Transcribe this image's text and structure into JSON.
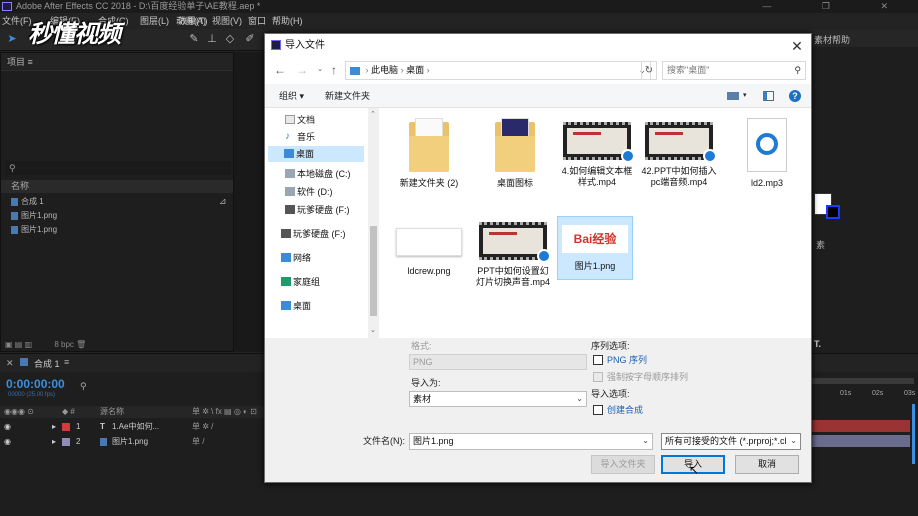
{
  "app": {
    "title": "Adobe After Effects CC 2018 - D:\\百度经验单子\\AE教程.aep *"
  },
  "menu": [
    "文件(F)",
    "编辑(E)",
    "合成(C)",
    "图层(L)",
    "效果(T)",
    "动画(A)",
    "视图(V)",
    "窗口",
    "帮助(H)"
  ],
  "watermark": "秒懂视频",
  "project_panel": {
    "title": "项目",
    "col_name": "名称",
    "items": [
      "合成 1",
      "图片1.png",
      "图片1.png"
    ],
    "bpc": "8 bpc"
  },
  "right_panel": {
    "label_top": "素材帮助",
    "label_mid": "素",
    "label_bot": "T."
  },
  "timeline": {
    "tab": "合成 1",
    "time": "0:00:00:00",
    "sub_time": "00000 (25.00 fps)",
    "col_name": "源名称",
    "layers": [
      {
        "num": "1",
        "type": "T",
        "name": "1.Ae中如何..."
      },
      {
        "num": "2",
        "type": "",
        "name": "图片1.png"
      }
    ],
    "ruler": [
      "01s",
      "02s",
      "03s"
    ]
  },
  "dialog": {
    "title": "导入文件",
    "breadcrumb": [
      "此电脑",
      "桌面"
    ],
    "search_placeholder": "搜索\"桌面\"",
    "organize": "组织 ▾",
    "new_folder": "新建文件夹",
    "nav": [
      "文档",
      "音乐",
      "桌面",
      "本地磁盘 (C:)",
      "软件 (D:)",
      "玩爹硬盘 (F:)",
      "玩爹硬盘 (F:)",
      "网络",
      "家庭组",
      "桌面"
    ],
    "files": [
      {
        "name": "新建文件夹 (2)",
        "kind": "folder"
      },
      {
        "name": "桌面图标",
        "kind": "folder2"
      },
      {
        "name": "4.如何编辑文本框样式.mp4",
        "kind": "video"
      },
      {
        "name": "42.PPT中如何插入pc端音频.mp4",
        "kind": "video"
      },
      {
        "name": "ld2.mp3",
        "kind": "audio"
      },
      {
        "name": "ldcrew.png",
        "kind": "blank"
      },
      {
        "name": "PPT中如何设置幻灯片切换声音.mp4",
        "kind": "video"
      },
      {
        "name": "图片1.png",
        "kind": "baidu"
      }
    ],
    "format_label": "格式:",
    "format_value": "PNG",
    "import_as_label": "导入为:",
    "import_as_value": "素材",
    "seq_label": "序列选项:",
    "seq_png": "PNG 序列",
    "seq_force": "强制按字母顺序排列",
    "import_opts_label": "导入选项:",
    "create_comp": "创建合成",
    "filename_label": "文件名(N):",
    "filename_value": "图片1.png",
    "filter_value": "所有可接受的文件 (*.prproj;*.cl",
    "btn_import_folder": "导入文件夹",
    "btn_import": "导入",
    "btn_cancel": "取消",
    "baidu_text": "Bai经验"
  }
}
